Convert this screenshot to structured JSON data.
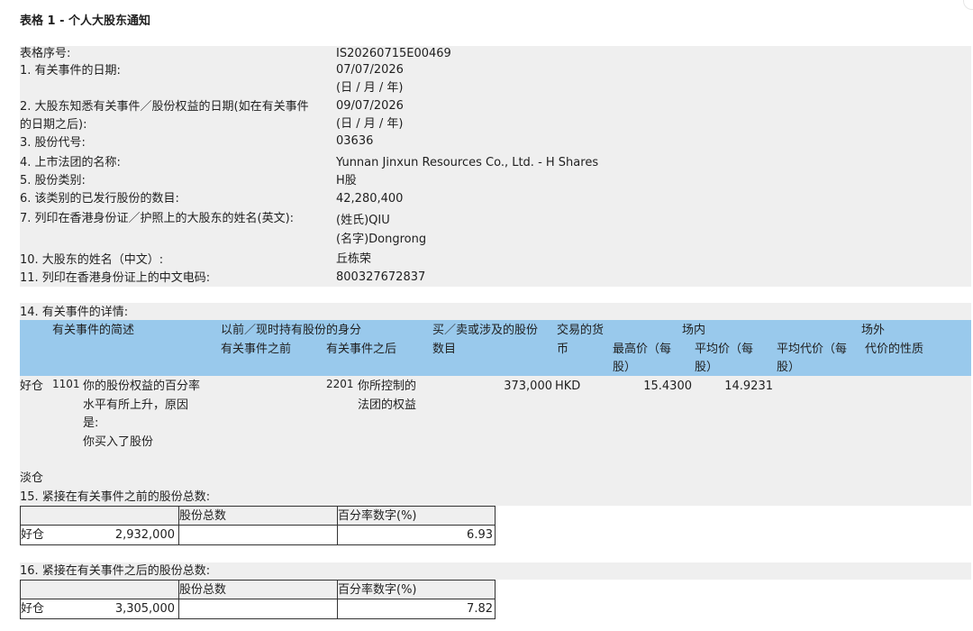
{
  "title": "表格 1 - 个人大股东通知",
  "fields": {
    "form_no": {
      "label": "表格序号:",
      "value": "IS20260715E00469"
    },
    "event_date": {
      "label": "1. 有关事件的日期:",
      "value": "07/07/2026",
      "hint": "(日 / 月 / 年)"
    },
    "aware_date": {
      "label_line1": "2. 大股东知悉有关事件／股份权益的日期(如在有关事件",
      "label_line2": "的日期之后):",
      "value": "09/07/2026",
      "hint": "(日 / 月 / 年)"
    },
    "stock_code": {
      "label": "3. 股份代号:",
      "value": "03636"
    },
    "issuer": {
      "label": "4. 上市法团的名称:",
      "value": "Yunnan Jinxun Resources Co., Ltd. - H Shares"
    },
    "share_class": {
      "label": "5. 股份类别:",
      "value": "H股"
    },
    "issued_shares": {
      "label": "6. 该类别的已发行股份的数目:",
      "value": "42,280,400"
    },
    "name_en": {
      "label": "7. 列印在香港身份证／护照上的大股东的姓名(英文):",
      "surname": "(姓氏)QIU",
      "given": "(名字)Dongrong"
    },
    "name_cn": {
      "label": "10. 大股东的姓名（中文）:",
      "value": "丘栋荣"
    },
    "cn_code": {
      "label": "11. 列印在香港身份证上的中文电码:",
      "value": "800327672837"
    }
  },
  "details": {
    "section_label": "14. 有关事件的详情:",
    "headers": {
      "event_desc": "有关事件的简述",
      "capacity": "以前／现时持有股份的身分",
      "before": "有关事件之前",
      "after": "有关事件之后",
      "shares_l1": "买／卖或涉及的股份",
      "shares_l2": "数目",
      "currency_l1": "交易的货",
      "currency_l2": "币",
      "onexch": "场内",
      "high_l1": "最高价（每",
      "high_l2": "股）",
      "avg_l1": "平均价（每",
      "avg_l2": "股）",
      "offexch": "场外",
      "offavg_l1": "平均代价（每",
      "offavg_l2": "股）",
      "nature": "代价的性质"
    },
    "row": {
      "position": "好仓",
      "code": "1101",
      "desc": [
        "你的股份权益的百分率",
        "水平有所上升，原因",
        "是:",
        "你买入了股份"
      ],
      "capacity_code": "2201",
      "capacity": [
        "你所控制的",
        "法团的权益"
      ],
      "shares": "373,000",
      "currency": "HKD",
      "high": "15.4300",
      "avg": "14.9231"
    },
    "short_label": "淡仓"
  },
  "before_total": {
    "section_label": "15. 紧接在有关事件之前的股份总数:",
    "col_shares": "股份总数",
    "col_pct": "百分率数字(%)",
    "row_label": "好仓",
    "shares": "2,932,000",
    "pct": "6.93"
  },
  "after_total": {
    "section_label": "16. 紧接在有关事件之后的股份总数:",
    "col_shares": "股份总数",
    "col_pct": "百分率数字(%)",
    "row_label": "好仓",
    "shares": "3,305,000",
    "pct": "7.82"
  }
}
